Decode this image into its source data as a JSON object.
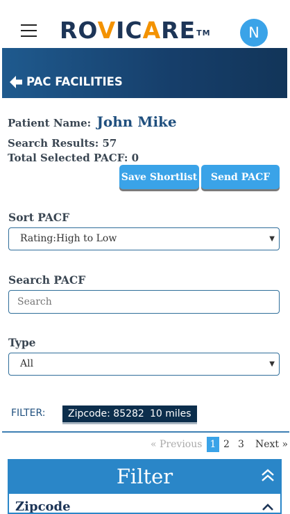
{
  "brand": {
    "logo_pre": "RO",
    "logo_v": "V",
    "logo_mid": "IC",
    "logo_a": "A",
    "logo_post": "RE",
    "logo_tm": "TM",
    "avatar_initial": "N",
    "accent": "#f39200",
    "navy": "#1d3557"
  },
  "banner": {
    "title": "PAC FACILITIES"
  },
  "patient": {
    "label": "Patient Name:",
    "name": "John Mike"
  },
  "results": {
    "search_label": "Search Results:",
    "search_value": "57",
    "selected_label": "Total Selected PACF:",
    "selected_value": "0"
  },
  "actions": {
    "save_shortlist": "Save Shortlist",
    "send_pacf": "Send PACF"
  },
  "sort": {
    "label": "Sort PACF",
    "selected": "Rating:High to Low"
  },
  "search": {
    "label": "Search PACF",
    "placeholder": "Search"
  },
  "type": {
    "label": "Type",
    "selected": "All"
  },
  "filters": {
    "label": "FILTER:",
    "chips": [
      "Zipcode: 85282",
      "10 miles"
    ]
  },
  "pagination": {
    "prev": "« Previous",
    "pages": [
      "1",
      "2",
      "3"
    ],
    "active_page": "1",
    "next": "Next »"
  },
  "filter_panel": {
    "title": "Filter",
    "section": "Zipcode"
  }
}
